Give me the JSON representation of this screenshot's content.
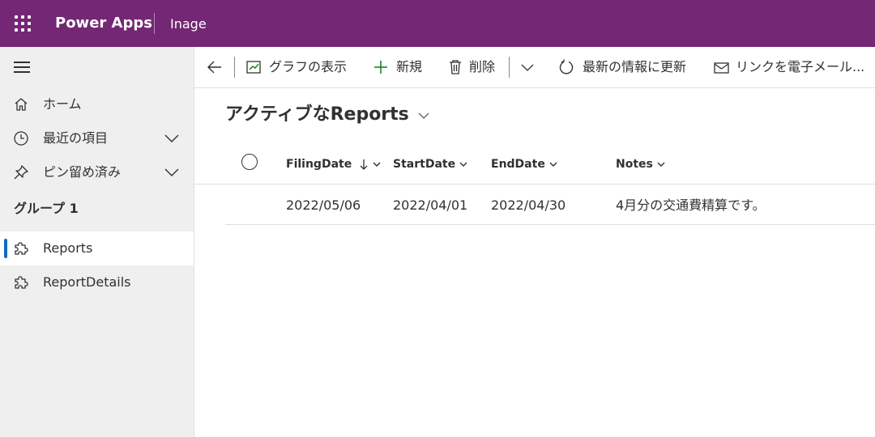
{
  "header": {
    "app_name": "Power Apps",
    "environment": "Inage",
    "color": "#742774"
  },
  "sidebar": {
    "items": [
      {
        "label": "ホーム",
        "icon": "home-icon"
      },
      {
        "label": "最近の項目",
        "icon": "clock-icon"
      },
      {
        "label": "ピン留め済み",
        "icon": "pin-icon"
      }
    ],
    "group_title": "グループ 1",
    "group_items": [
      {
        "label": "Reports",
        "icon": "puzzle-icon",
        "selected": true
      },
      {
        "label": "ReportDetails",
        "icon": "puzzle-icon",
        "selected": false
      }
    ],
    "selection_color": "#0f6cbd"
  },
  "commands": {
    "show_chart": "グラフの表示",
    "new": "新規",
    "delete": "削除",
    "refresh": "最新の情報に更新",
    "email_link": "リンクを電子メール..."
  },
  "view": {
    "title": "アクティブなReports"
  },
  "grid": {
    "columns": [
      "FilingDate",
      "StartDate",
      "EndDate",
      "Notes"
    ],
    "sorted_column": "FilingDate",
    "sort_direction": "descending",
    "rows": [
      {
        "FilingDate": "2022/05/06",
        "StartDate": "2022/04/01",
        "EndDate": "2022/04/30",
        "Notes": "4月分の交通費精算です。"
      }
    ]
  }
}
